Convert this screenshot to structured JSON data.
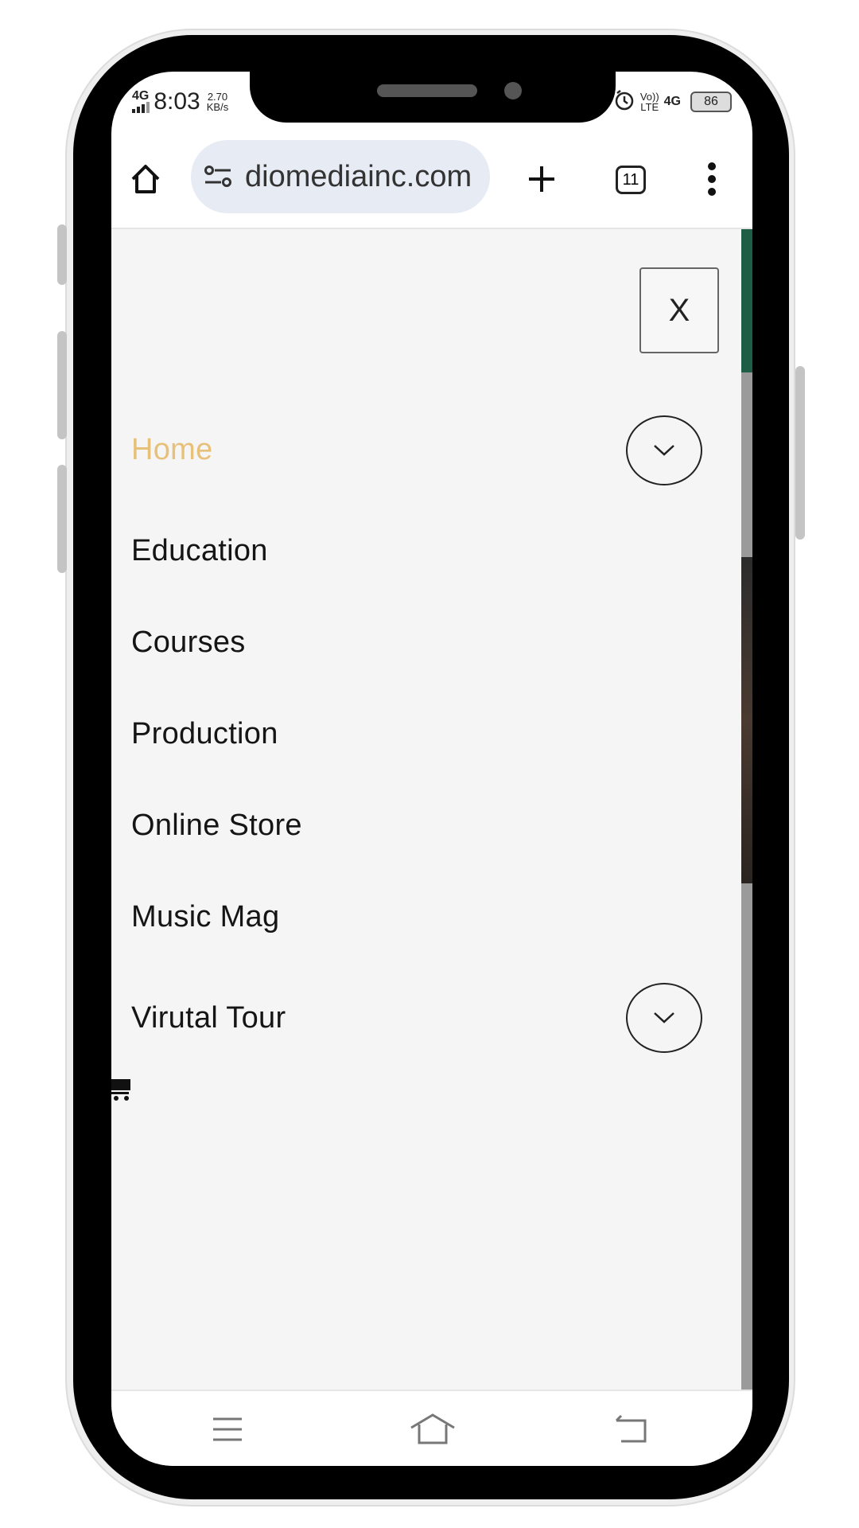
{
  "status_bar": {
    "network_type": "4G",
    "time": "8:03",
    "data_speed_value": "2.70",
    "data_speed_unit": "KB/s",
    "volte": "Vo))",
    "lte": "LTE",
    "right_network": "4G",
    "battery_level": "86"
  },
  "browser": {
    "url": "diomediainc.com",
    "tab_count": "11"
  },
  "menu": {
    "close_label": "X",
    "items": [
      {
        "label": "Home"
      },
      {
        "label": "Education"
      },
      {
        "label": "Courses"
      },
      {
        "label": "Production"
      },
      {
        "label": "Online Store"
      },
      {
        "label": "Music Mag"
      },
      {
        "label": "Virutal Tour"
      }
    ]
  },
  "colors": {
    "active_menu": "#e7c07a",
    "url_bar": "#e6ebf4",
    "drawer_bg": "#f5f5f5"
  },
  "icons": [
    "home-icon",
    "site-settings-icon",
    "new-tab-plus-icon",
    "tab-switcher-icon",
    "more-vert-icon",
    "chevron-down-icon",
    "cart-icon",
    "recents-icon",
    "home-nav-icon",
    "back-icon",
    "alarm-icon"
  ]
}
